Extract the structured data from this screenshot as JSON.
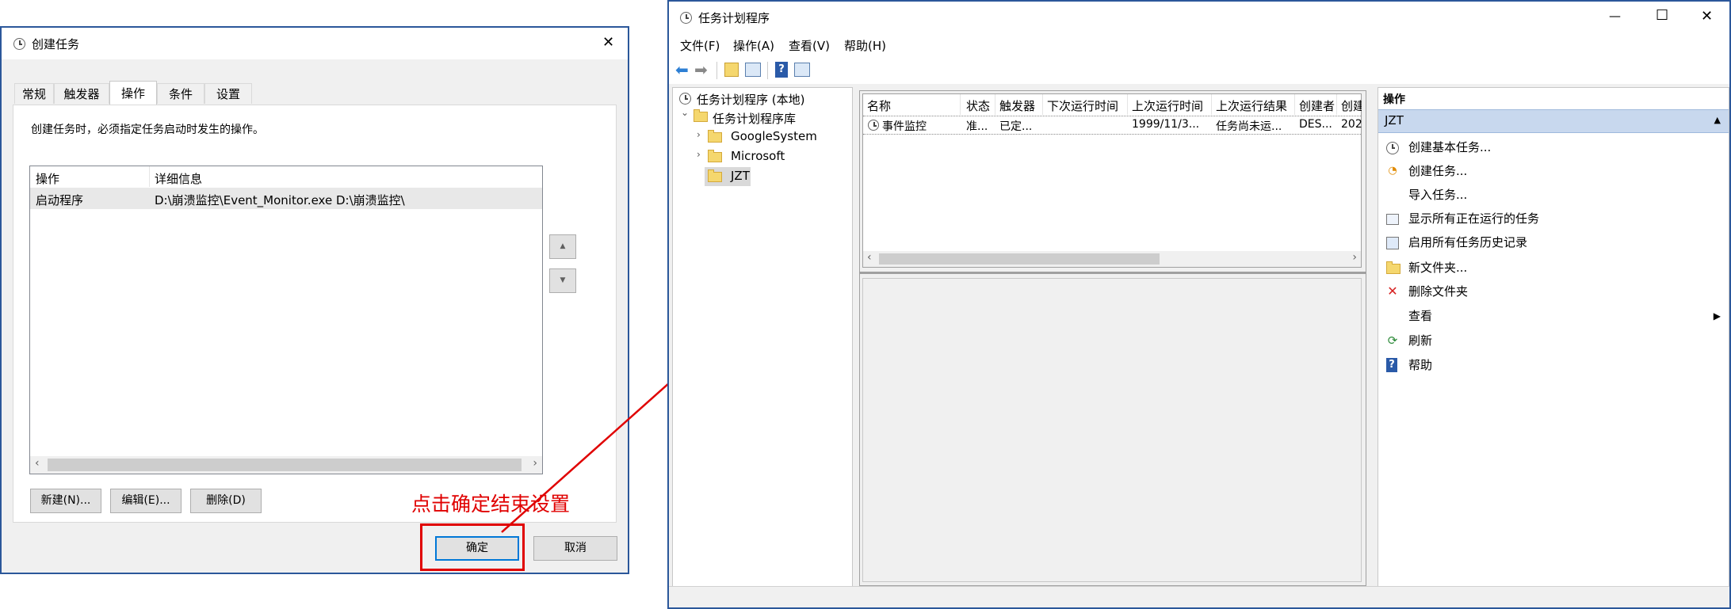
{
  "create_task_dialog": {
    "title": "创建任务",
    "tabs": [
      "常规",
      "触发器",
      "操作",
      "条件",
      "设置"
    ],
    "description": "创建任务时，必须指定任务启动时发生的操作。",
    "table": {
      "columns": [
        "操作",
        "详细信息"
      ],
      "rows": [
        {
          "action": "启动程序",
          "details": "D:\\崩溃监控\\Event_Monitor.exe D:\\崩溃监控\\"
        }
      ]
    },
    "up_arrow": "▲",
    "down_arrow": "▼",
    "buttons": {
      "new": "新建(N)...",
      "edit": "编辑(E)...",
      "delete": "删除(D)"
    },
    "ok": "确定",
    "cancel": "取消",
    "close": "✕"
  },
  "annotation": {
    "text": "点击确定结束设置",
    "color": "#e00000"
  },
  "scheduler": {
    "title": "任务计划程序",
    "window_controls": {
      "minimize": "—",
      "maximize": "☐",
      "close": "✕"
    },
    "menu": [
      "文件(F)",
      "操作(A)",
      "查看(V)",
      "帮助(H)"
    ],
    "tree": {
      "root": "任务计划程序 (本地)",
      "library": "任务计划程序库",
      "folders": [
        "GoogleSystem",
        "Microsoft",
        "JZT"
      ]
    },
    "task_table": {
      "columns": [
        "名称",
        "状态",
        "触发器",
        "下次运行时间",
        "上次运行时间",
        "上次运行结果",
        "创建者",
        "创建"
      ],
      "rows": [
        {
          "name": "事件监控",
          "status": "准...",
          "trigger": "已定...",
          "next": "",
          "last": "1999/11/3...",
          "result": "任务尚未运...",
          "author": "DES...",
          "created": "202"
        }
      ]
    },
    "actions": {
      "header": "操作",
      "section": "JZT",
      "items": [
        {
          "label": "创建基本任务...",
          "icon": "clock-wand-icon"
        },
        {
          "label": "创建任务...",
          "icon": "clock-new-icon"
        },
        {
          "label": "导入任务...",
          "icon": ""
        },
        {
          "label": "显示所有正在运行的任务",
          "icon": "running-tasks-icon"
        },
        {
          "label": "启用所有任务历史记录",
          "icon": "history-icon"
        },
        {
          "label": "新文件夹...",
          "icon": "new-folder-icon"
        },
        {
          "label": "删除文件夹",
          "icon": "delete-icon"
        },
        {
          "label": "查看",
          "icon": ""
        },
        {
          "label": "刷新",
          "icon": "refresh-icon"
        },
        {
          "label": "帮助",
          "icon": "help-icon"
        }
      ]
    }
  }
}
